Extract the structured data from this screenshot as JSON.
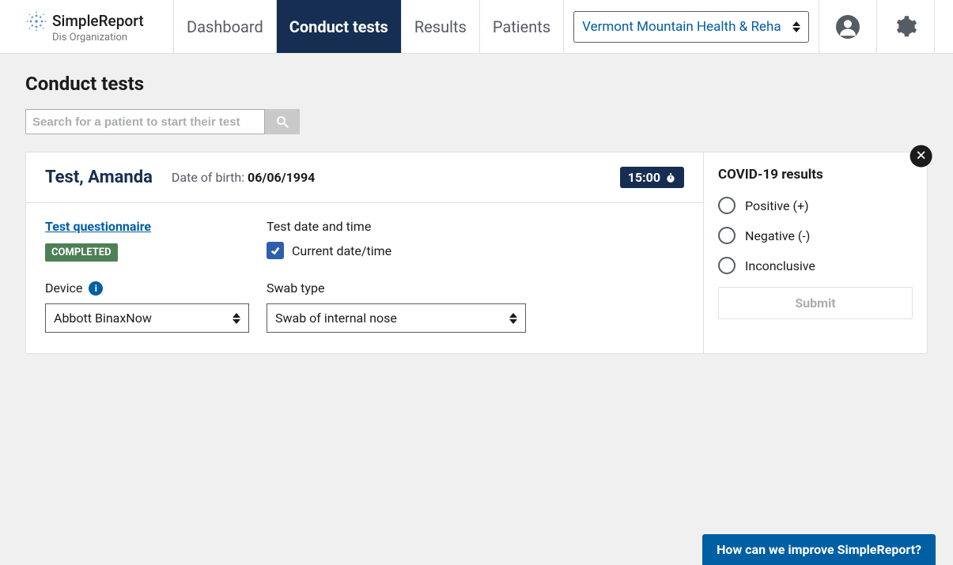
{
  "brand": {
    "name": "SimpleReport",
    "sub": "Dis Organization"
  },
  "nav": {
    "items": [
      {
        "label": "Dashboard"
      },
      {
        "label": "Conduct tests"
      },
      {
        "label": "Results"
      },
      {
        "label": "Patients"
      }
    ],
    "active_index": 1
  },
  "facility": {
    "selected": "Vermont Mountain Health & Reha"
  },
  "page": {
    "title": "Conduct tests"
  },
  "search": {
    "placeholder": "Search for a patient to start their test",
    "value": ""
  },
  "test_card": {
    "patient_name": "Test, Amanda",
    "dob_label": "Date of birth: ",
    "dob_value": "06/06/1994",
    "timer": "15:00",
    "questionnaire_link": "Test questionnaire",
    "questionnaire_status": "COMPLETED",
    "datetime_label": "Test date and time",
    "current_dt_label": "Current date/time",
    "current_dt_checked": true,
    "device_label": "Device",
    "device_value": "Abbott BinaxNow",
    "swab_label": "Swab type",
    "swab_value": "Swab of internal nose"
  },
  "results": {
    "title": "COVID-19 results",
    "options": [
      {
        "label": "Positive (+)"
      },
      {
        "label": "Negative (-)"
      },
      {
        "label": "Inconclusive"
      }
    ],
    "submit": "Submit"
  },
  "feedback": {
    "label": "How can we improve SimpleReport?"
  }
}
